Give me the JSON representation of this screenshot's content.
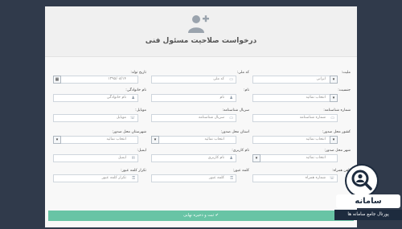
{
  "page": {
    "title": "درخواست صلاحیت مسئول فنی"
  },
  "form": {
    "nationality": {
      "label": "ملیت:",
      "value": "ایرانی"
    },
    "first_name": {
      "label": "نام:",
      "placeholder": "نام"
    },
    "gender": {
      "label": "جنسیت:",
      "value": "انتخاب نمائید"
    },
    "last_name": {
      "label": "نام خانوادگی:",
      "placeholder": "نام خانوادگی"
    },
    "national_code": {
      "label": "کد ملی:",
      "placeholder": "کد ملی"
    },
    "birth_date": {
      "label": "تاریخ تولد:",
      "value": "۱۳۹۵/۰۸/۱۴"
    },
    "id_number": {
      "label": "شماره شناسنامه:",
      "placeholder": "شماره شناسنامه"
    },
    "id_serial": {
      "label": "سریال شناسنامه:",
      "placeholder": "سریال شناسنامه"
    },
    "mobile": {
      "label": "موبایل:",
      "placeholder": "موبایل"
    },
    "birth_country": {
      "label": "کشور محل صدور:",
      "value": "انتخاب نمائید"
    },
    "birth_province": {
      "label": "استان محل صدور:",
      "value": "انتخاب نمائید"
    },
    "birth_city": {
      "label": "شهرستان محل صدور:",
      "value": "انتخاب نمائید"
    },
    "issue_city": {
      "label": "شهر محل صدور:",
      "value": "انتخاب نمائید"
    },
    "username": {
      "label": "نام کاربری:",
      "placeholder": "نام کاربری"
    },
    "email": {
      "label": "ایمیل:",
      "placeholder": "ایمیل"
    },
    "mobile_verified": {
      "label": "تلفن همراه:",
      "placeholder": "شماره همراه"
    },
    "password": {
      "label": "کلمه عبور:",
      "placeholder": "کلمه عبور"
    },
    "password_repeat": {
      "label": "تکرار کلمه عبور:",
      "placeholder": "تکرار کلمه عبور"
    }
  },
  "submit": {
    "label": "ثبت و ذخیره نهایی"
  },
  "brand": {
    "name": "سامانه",
    "tagline": "پورتال جامع سامانه ها"
  }
}
